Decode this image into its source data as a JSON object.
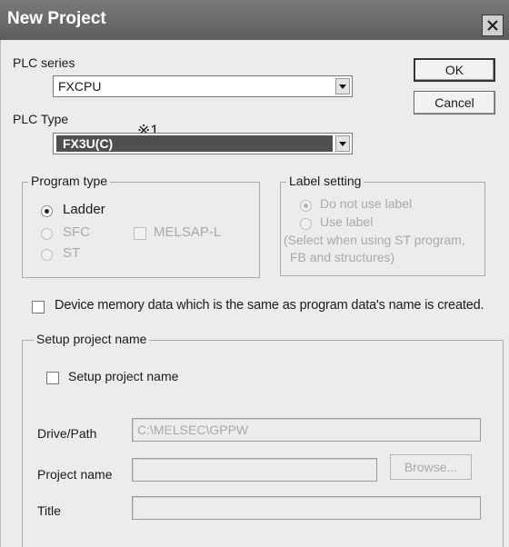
{
  "window": {
    "title": "New Project"
  },
  "plc_series": {
    "label": "PLC series",
    "value": "FXCPU"
  },
  "plc_type": {
    "label": "PLC Type",
    "value": "FX3U(C)",
    "note": "※1"
  },
  "buttons": {
    "ok": "OK",
    "cancel": "Cancel",
    "browse": "Browse..."
  },
  "program_type": {
    "legend": "Program type",
    "ladder": "Ladder",
    "sfc": "SFC",
    "st": "ST",
    "melsap": "MELSAP-L",
    "selected": "Ladder"
  },
  "label_setting": {
    "legend": "Label setting",
    "do_not_use": "Do not use label",
    "use": "Use label",
    "note_line1": "(Select when using ST program,",
    "note_line2": "FB and structures)",
    "selected": "Do not use label"
  },
  "device_memory": {
    "label": "Device memory data which is the same as program data's name is created.",
    "checked": false
  },
  "setup": {
    "legend": "Setup project name",
    "checkbox_label": "Setup project name",
    "checked": false,
    "drive_path_label": "Drive/Path",
    "drive_path_value": "C:\\MELSEC\\GPPW",
    "project_name_label": "Project name",
    "project_name_value": "",
    "title_label": "Title",
    "title_value": ""
  }
}
